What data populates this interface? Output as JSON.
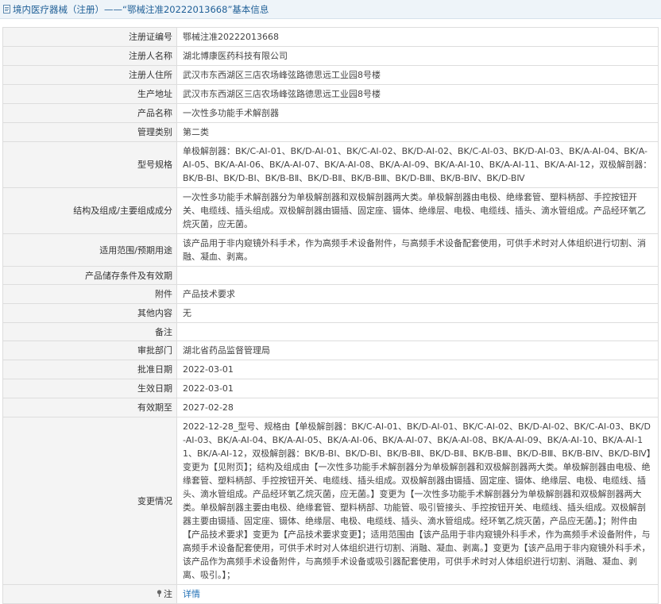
{
  "title": "境内医疗器械（注册）——“鄂械注准20222013668”基本信息",
  "colors": {
    "title_bg": "#eef4f9",
    "title_text": "#1f5f97",
    "label_bg": "#f4f4f4",
    "border": "#dddddd",
    "link": "#1f6fb5"
  },
  "rows": [
    {
      "label": "注册证编号",
      "value": "鄂械注准20222013668"
    },
    {
      "label": "注册人名称",
      "value": "湖北博康医药科技有限公司"
    },
    {
      "label": "注册人住所",
      "value": "武汉市东西湖区三店农场峰弦路德思远工业园8号楼"
    },
    {
      "label": "生产地址",
      "value": "武汉市东西湖区三店农场峰弦路德思远工业园8号楼"
    },
    {
      "label": "产品名称",
      "value": "一次性多功能手术解剖器"
    },
    {
      "label": "管理类别",
      "value": "第二类"
    },
    {
      "label": "型号规格",
      "value": "单极解剖器：BK/C-AⅠ-01、BK/D-AⅠ-01、BK/C-AⅠ-02、BK/D-AⅠ-02、BK/C-AⅠ-03、BK/D-AⅠ-03、BK/A-AⅠ-04、BK/A-AⅠ-05、BK/A-AⅠ-06、BK/A-AⅠ-07、BK/A-AⅠ-08、BK/A-AⅠ-09、BK/A-AⅠ-10、BK/A-AⅠ-11、BK/A-AⅠ-12，双极解剖器：BK/B-BⅠ、BK/D-BⅠ、BK/B-BⅡ、BK/D-BⅡ、BK/B-BⅢ、BK/D-BⅢ、BK/B-BⅣ、BK/D-BⅣ"
    },
    {
      "label": "结构及组成/主要组成成分",
      "value": "一次性多功能手术解剖器分为单极解剖器和双极解剖器两大类。单极解剖器由电极、绝缘套管、塑料柄部、手控按钮开关、电缆线、插头组成。双极解剖器由镊插、固定座、镊体、绝缘层、电极、电缆线、插头、滴水管组成。产品经环氧乙烷灭菌，应无菌。"
    },
    {
      "label": "适用范围/预期用途",
      "value": "该产品用于非内窥镜外科手术，作为高频手术设备附件，与高频手术设备配套使用，可供手术时对人体组织进行切割、消融、凝血、剥离。"
    },
    {
      "label": "产品储存条件及有效期",
      "value": ""
    },
    {
      "label": "附件",
      "value": "产品技术要求"
    },
    {
      "label": "其他内容",
      "value": "无"
    },
    {
      "label": "备注",
      "value": ""
    },
    {
      "label": "审批部门",
      "value": "湖北省药品监督管理局"
    },
    {
      "label": "批准日期",
      "value": "2022-03-01"
    },
    {
      "label": "生效日期",
      "value": "2022-03-01"
    },
    {
      "label": "有效期至",
      "value": "2027-02-28"
    },
    {
      "label": "变更情况",
      "value": "2022-12-28_型号、规格由【单极解剖器：BK/C-AⅠ-01、BK/D-AⅠ-01、BK/C-AⅠ-02、BK/D-AⅠ-02、BK/C-AⅠ-03、BK/D-AⅠ-03、BK/A-AⅠ-04、BK/A-AⅠ-05、BK/A-AⅠ-06、BK/A-AⅠ-07、BK/A-AⅠ-08、BK/A-AⅠ-09、BK/A-AⅠ-10、BK/A-AⅠ-11、BK/A-AⅠ-12，双极解剖器：BK/B-BⅠ、BK/D-BⅠ、BK/B-BⅡ、BK/D-BⅡ、BK/B-BⅢ、BK/D-BⅢ、BK/B-BⅣ、BK/D-BⅣ】变更为【见附页】；结构及组成由【一次性多功能手术解剖器分为单极解剖器和双极解剖器两大类。单极解剖器由电极、绝缘套管、塑料柄部、手控按钮开关、电缆线、插头组成。双极解剖器由镊插、固定座、镊体、绝缘层、电极、电缆线、插头、滴水管组成。产品经环氧乙烷灭菌，应无菌。】变更为【一次性多功能手术解剖器分为单极解剖器和双极解剖器两大类。单极解剖器主要由电极、绝缘套管、塑料柄部、功能管、吸引管接头、手控按钮开关、电缆线、插头组成。双极解剖器主要由镊插、固定座、镊体、绝缘层、电极、电缆线、插头、滴水管组成。经环氧乙烷灭菌，产品应无菌。】；附件由【产品技术要求】变更为【产品技术要求变更】；适用范围由【该产品用于非内窥镜外科手术，作为高频手术设备附件，与高频手术设备配套使用，可供手术时对人体组织进行切割、消融、凝血、剥离。】变更为【该产品用于非内窥镜外科手术，该产品作为高频手术设备附件，与高频手术设备或吸引器配套使用，可供手术时对人体组织进行切割、消融、凝血、剥离、吸引。】；"
    },
    {
      "label": "注",
      "value": "详情",
      "icon": "pin-icon"
    }
  ]
}
